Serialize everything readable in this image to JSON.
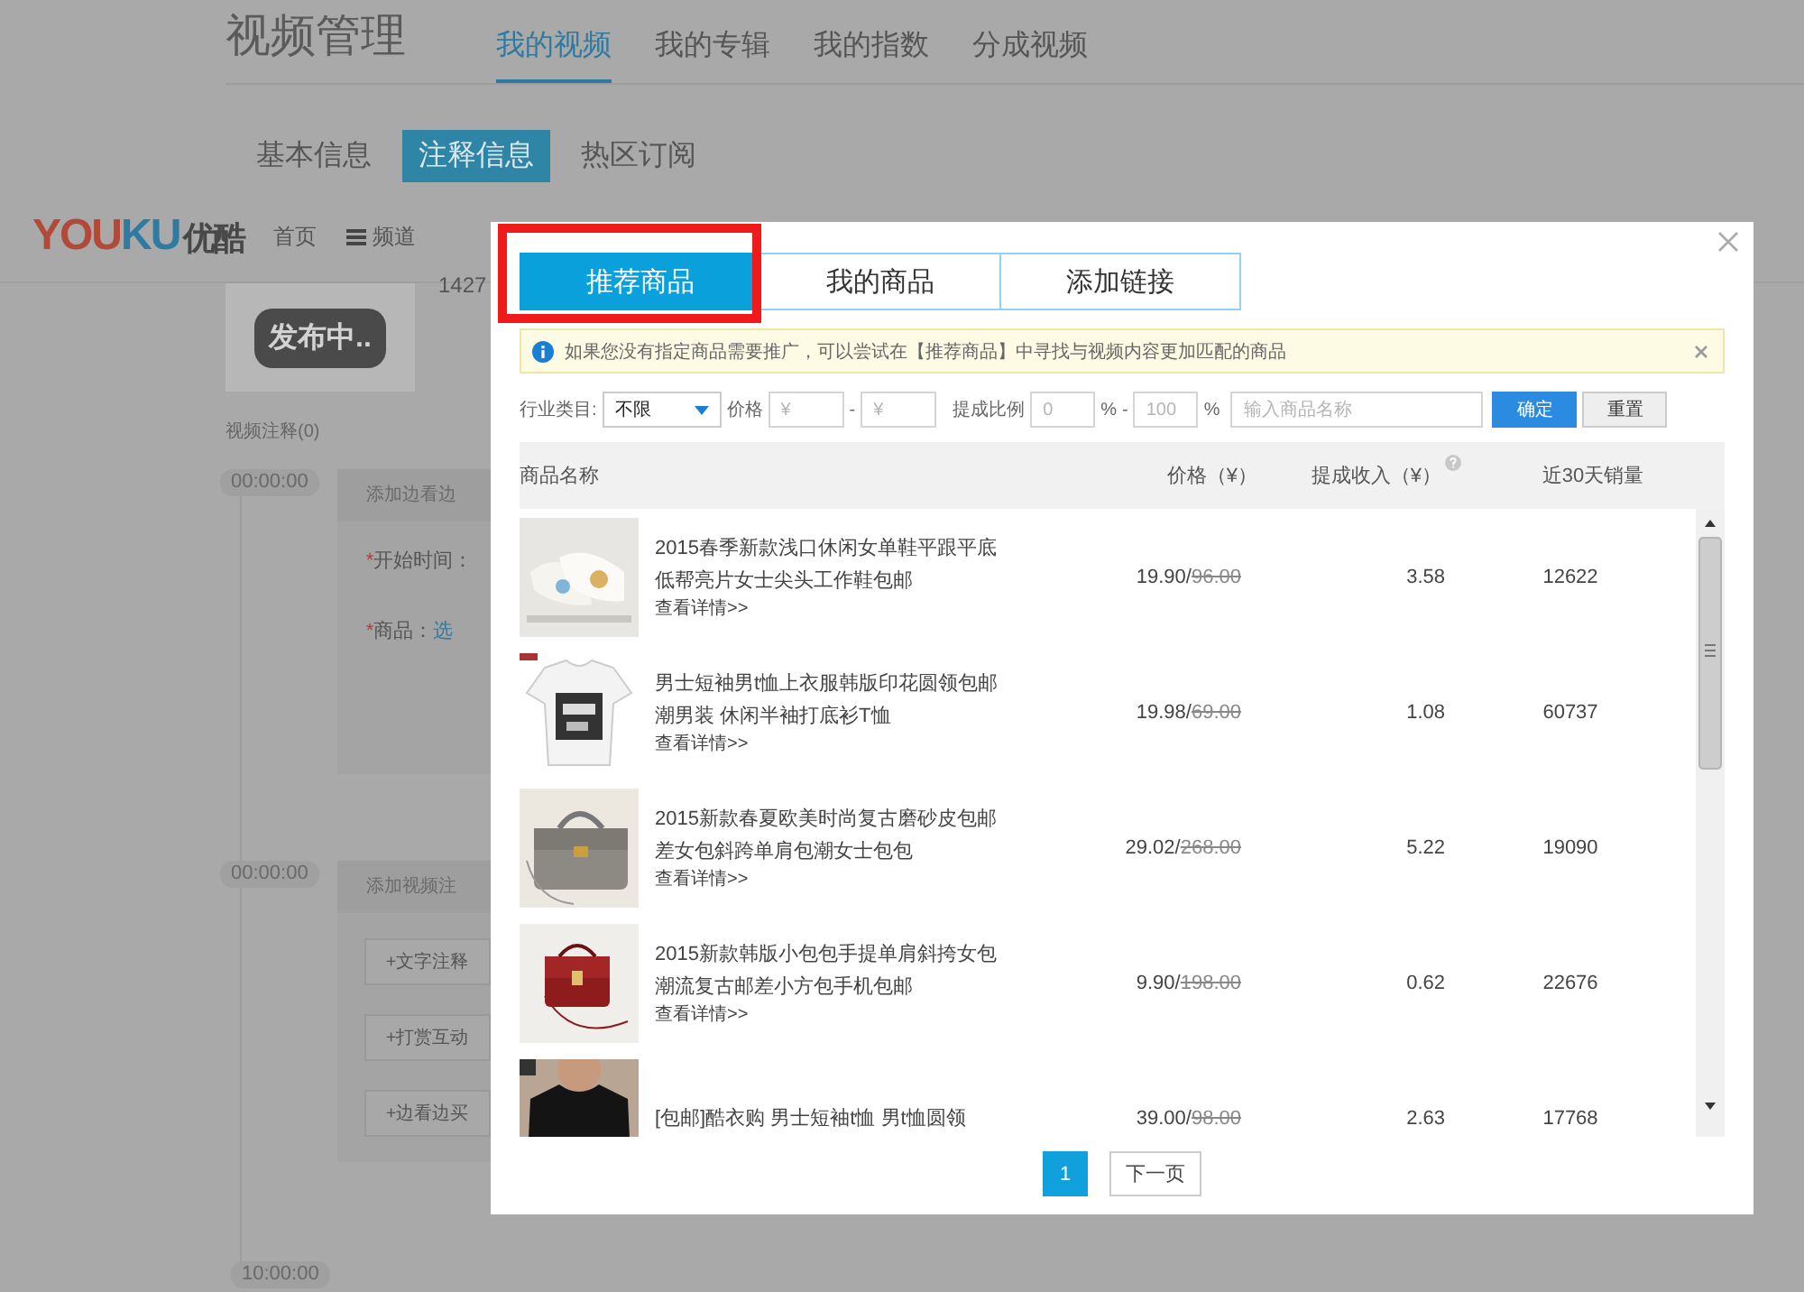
{
  "page": {
    "title": "视频管理",
    "tabs": [
      {
        "label": "我的视频",
        "selected": true
      },
      {
        "label": "我的专辑",
        "selected": false
      },
      {
        "label": "我的指数",
        "selected": false
      },
      {
        "label": "分成视频",
        "selected": false
      }
    ],
    "subtabs": [
      {
        "label": "基本信息",
        "selected": false
      },
      {
        "label": "注释信息",
        "selected": true
      },
      {
        "label": "热区订阅",
        "selected": false
      }
    ]
  },
  "site_bar": {
    "logo": {
      "part_1": "YOU",
      "part_2": "KU",
      "name": "优酷"
    },
    "nav": [
      {
        "label": "首页",
        "menu_icon": false
      },
      {
        "label": "频道",
        "menu_icon": true
      }
    ]
  },
  "video": {
    "status": "发布中..",
    "id_fragment": "1427"
  },
  "annotations_label": "视频注释(0)",
  "timeline": [
    {
      "time": "00:00:00",
      "panel": {
        "title": "添加边看边",
        "fields": [
          {
            "label": "开始时间：",
            "required_mark": "*"
          },
          {
            "label": "商品：",
            "required_mark": "*",
            "link": "选"
          }
        ]
      }
    },
    {
      "time": "00:00:00",
      "panel": {
        "title": "添加视频注",
        "buttons": [
          "+文字注释",
          "+打赏互动",
          "+边看边买"
        ]
      }
    },
    {
      "time": "10:00:00"
    }
  ],
  "modal": {
    "tabs": [
      {
        "label": "推荐商品",
        "selected": true
      },
      {
        "label": "我的商品",
        "selected": false
      },
      {
        "label": "添加链接",
        "selected": false
      }
    ],
    "notice": "如果您没有指定商品需要推广，可以尝试在【推荐商品】中寻找与视频内容更加匹配的商品",
    "filter": {
      "category_label": "行业类目:",
      "category_value": "不限",
      "price_label": "价格",
      "price_min_placeholder": "¥",
      "price_separator": "-",
      "price_max_placeholder": "¥",
      "ratio_label": "提成比例",
      "ratio_min_placeholder": "0",
      "ratio_min_unit": "%",
      "ratio_separator": "-",
      "ratio_max_placeholder": "100",
      "ratio_max_unit": "%",
      "search_placeholder": "输入商品名称",
      "confirm": "确定",
      "reset": "重置"
    },
    "table": {
      "columns": [
        {
          "label": "商品名称"
        },
        {
          "label": "价格（¥）"
        },
        {
          "label": "提成收入（¥）"
        },
        {
          "label": "近30天销量"
        }
      ],
      "rows": [
        {
          "name": "2015春季新款浅口休闲女单鞋平跟平底低帮亮片女士尖头工作鞋包邮",
          "details": "查看详情>>",
          "price": "19.90/",
          "list_price": "96.00",
          "commission": "3.58",
          "sales": "12622"
        },
        {
          "name": "男士短袖男t恤上衣服韩版印花圆领包邮潮男装 休闲半袖打底衫T恤",
          "details": "查看详情>>",
          "price": "19.98/",
          "list_price": "69.00",
          "commission": "1.08",
          "sales": "60737"
        },
        {
          "name": "2015新款春夏欧美时尚复古磨砂皮包邮差女包斜跨单肩包潮女士包包",
          "details": "查看详情>>",
          "price": "29.02/",
          "list_price": "268.00",
          "commission": "5.22",
          "sales": "19090"
        },
        {
          "name": "2015新款韩版小包包手提单肩斜挎女包潮流复古邮差小方包手机包邮",
          "details": "查看详情>>",
          "price": "9.90/",
          "list_price": "198.00",
          "commission": "0.62",
          "sales": "22676"
        },
        {
          "name": "[包邮]酷衣购 男士短袖t恤 男t恤圆领",
          "price": "39.00/",
          "list_price": "98.00",
          "commission": "2.63",
          "sales": "17768"
        }
      ]
    },
    "pagination": {
      "pages": [
        {
          "label": "1",
          "selected": true
        }
      ],
      "next": "下一页"
    }
  }
}
